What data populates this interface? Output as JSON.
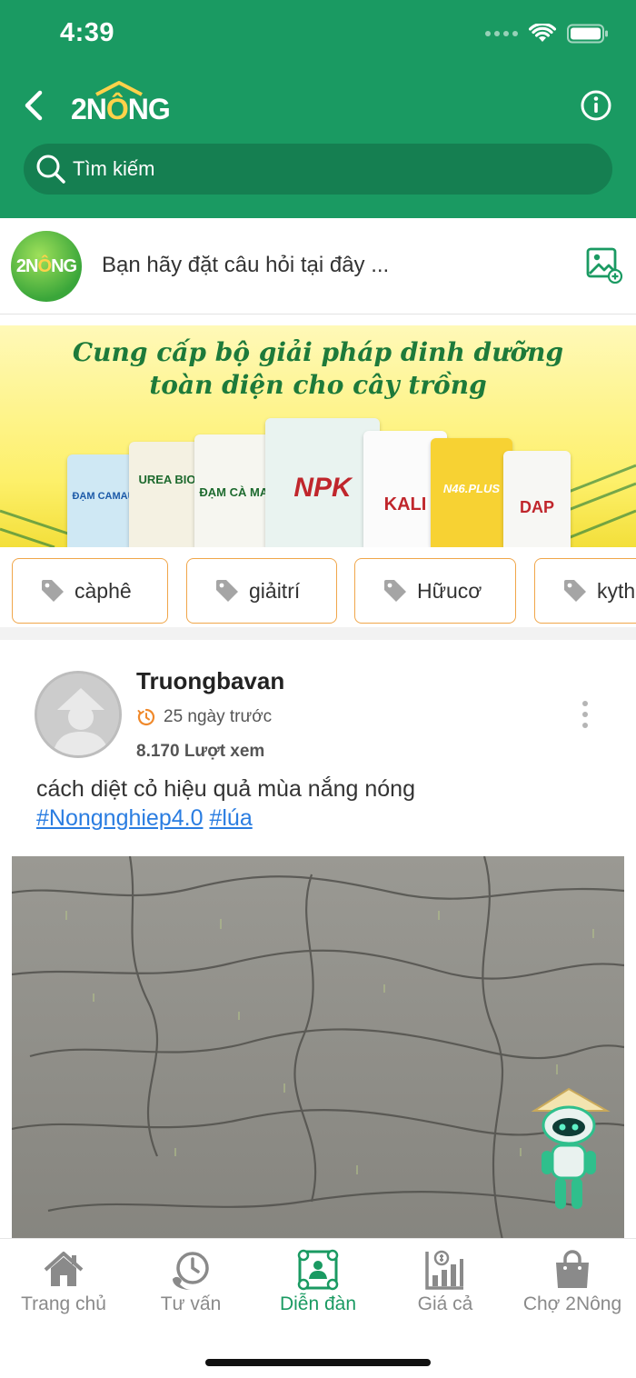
{
  "status_bar": {
    "time": "4:39"
  },
  "header": {
    "logo_text_prefix": "2N",
    "logo_text_accent": "Ô",
    "logo_text_suffix": "NG",
    "search_placeholder": "Tìm kiếm",
    "brand_color": "#1a9a62"
  },
  "ask": {
    "avatar_prefix": "2N",
    "avatar_accent": "Ô",
    "avatar_suffix": "NG",
    "prompt": "Bạn hãy đặt câu hỏi tại đây ..."
  },
  "banner": {
    "line1": "Cung cấp bộ giải pháp dinh dưỡng",
    "line2": "toàn diện cho cây trồng",
    "products": [
      "ĐẠM CAMAU",
      "UREA BIO",
      "ĐẠM CÀ MAU",
      "NPK",
      "KALI",
      "N46.PLUS",
      "DAP"
    ]
  },
  "tags": [
    {
      "label": "càphê"
    },
    {
      "label": "giảitrí"
    },
    {
      "label": "Hữucơ"
    },
    {
      "label": "kyth"
    }
  ],
  "post": {
    "author": "Truongbavan",
    "time": "25 ngày trước",
    "views": "8.170 Lượt xem",
    "text": "cách diệt cỏ hiệu quả mùa nắng nóng",
    "hashtags": [
      "#Nongnghiep4.0",
      "#lúa"
    ]
  },
  "tabbar": {
    "active_color": "#1a9a62",
    "items": [
      {
        "label": "Trang chủ",
        "icon": "home-icon"
      },
      {
        "label": "Tư vấn",
        "icon": "phone-clock-icon"
      },
      {
        "label": "Diễn đàn",
        "icon": "forum-icon"
      },
      {
        "label": "Giá cả",
        "icon": "price-chart-icon"
      },
      {
        "label": "Chợ 2Nông",
        "icon": "shopping-bag-icon"
      }
    ]
  }
}
